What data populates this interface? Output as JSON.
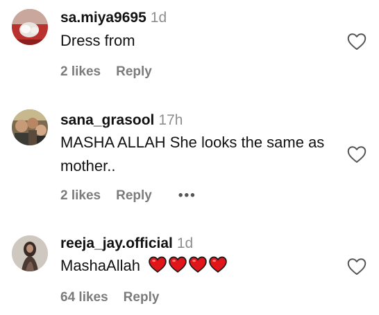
{
  "comments": [
    {
      "username": "sa.miya9695",
      "time": "1d",
      "text": "Dress from",
      "likes": "2 likes",
      "reply": "Reply",
      "more": ""
    },
    {
      "username": "sana_grasool",
      "time": "17h",
      "text": "MASHA ALLAH She looks the same as mother..",
      "likes": "2 likes",
      "reply": "Reply",
      "more": "•••"
    },
    {
      "username": "reeja_jay.official",
      "time": "1d",
      "text": "MashaAllah",
      "emoji": [
        "red-heart",
        "red-heart",
        "red-heart",
        "red-heart"
      ],
      "likes": "64 likes",
      "reply": "Reply",
      "more": ""
    }
  ],
  "colors": {
    "muted": "#8e8e8e",
    "heart": "#e0161b"
  }
}
